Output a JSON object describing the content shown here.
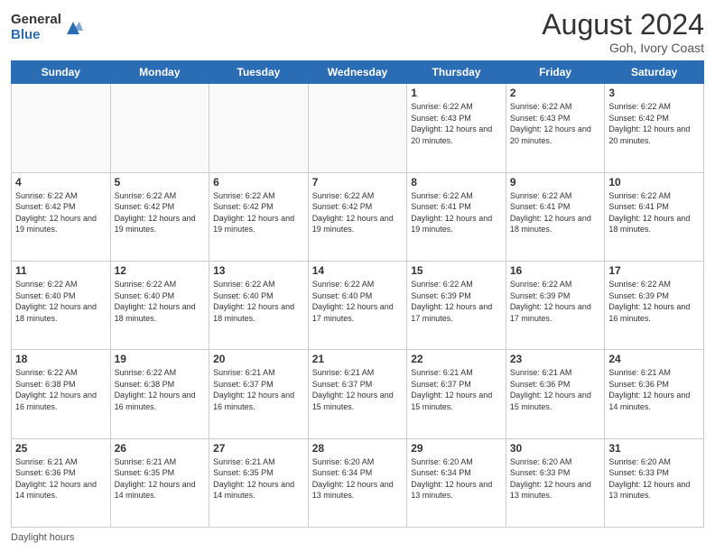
{
  "logo": {
    "general": "General",
    "blue": "Blue"
  },
  "title": "August 2024",
  "location": "Goh, Ivory Coast",
  "days_of_week": [
    "Sunday",
    "Monday",
    "Tuesday",
    "Wednesday",
    "Thursday",
    "Friday",
    "Saturday"
  ],
  "footer": {
    "daylight_label": "Daylight hours"
  },
  "weeks": [
    [
      {
        "day": "",
        "empty": true
      },
      {
        "day": "",
        "empty": true
      },
      {
        "day": "",
        "empty": true
      },
      {
        "day": "",
        "empty": true
      },
      {
        "day": "1",
        "sunrise": "Sunrise: 6:22 AM",
        "sunset": "Sunset: 6:43 PM",
        "daylight": "Daylight: 12 hours and 20 minutes."
      },
      {
        "day": "2",
        "sunrise": "Sunrise: 6:22 AM",
        "sunset": "Sunset: 6:43 PM",
        "daylight": "Daylight: 12 hours and 20 minutes."
      },
      {
        "day": "3",
        "sunrise": "Sunrise: 6:22 AM",
        "sunset": "Sunset: 6:42 PM",
        "daylight": "Daylight: 12 hours and 20 minutes."
      }
    ],
    [
      {
        "day": "4",
        "sunrise": "Sunrise: 6:22 AM",
        "sunset": "Sunset: 6:42 PM",
        "daylight": "Daylight: 12 hours and 19 minutes."
      },
      {
        "day": "5",
        "sunrise": "Sunrise: 6:22 AM",
        "sunset": "Sunset: 6:42 PM",
        "daylight": "Daylight: 12 hours and 19 minutes."
      },
      {
        "day": "6",
        "sunrise": "Sunrise: 6:22 AM",
        "sunset": "Sunset: 6:42 PM",
        "daylight": "Daylight: 12 hours and 19 minutes."
      },
      {
        "day": "7",
        "sunrise": "Sunrise: 6:22 AM",
        "sunset": "Sunset: 6:42 PM",
        "daylight": "Daylight: 12 hours and 19 minutes."
      },
      {
        "day": "8",
        "sunrise": "Sunrise: 6:22 AM",
        "sunset": "Sunset: 6:41 PM",
        "daylight": "Daylight: 12 hours and 19 minutes."
      },
      {
        "day": "9",
        "sunrise": "Sunrise: 6:22 AM",
        "sunset": "Sunset: 6:41 PM",
        "daylight": "Daylight: 12 hours and 18 minutes."
      },
      {
        "day": "10",
        "sunrise": "Sunrise: 6:22 AM",
        "sunset": "Sunset: 6:41 PM",
        "daylight": "Daylight: 12 hours and 18 minutes."
      }
    ],
    [
      {
        "day": "11",
        "sunrise": "Sunrise: 6:22 AM",
        "sunset": "Sunset: 6:40 PM",
        "daylight": "Daylight: 12 hours and 18 minutes."
      },
      {
        "day": "12",
        "sunrise": "Sunrise: 6:22 AM",
        "sunset": "Sunset: 6:40 PM",
        "daylight": "Daylight: 12 hours and 18 minutes."
      },
      {
        "day": "13",
        "sunrise": "Sunrise: 6:22 AM",
        "sunset": "Sunset: 6:40 PM",
        "daylight": "Daylight: 12 hours and 18 minutes."
      },
      {
        "day": "14",
        "sunrise": "Sunrise: 6:22 AM",
        "sunset": "Sunset: 6:40 PM",
        "daylight": "Daylight: 12 hours and 17 minutes."
      },
      {
        "day": "15",
        "sunrise": "Sunrise: 6:22 AM",
        "sunset": "Sunset: 6:39 PM",
        "daylight": "Daylight: 12 hours and 17 minutes."
      },
      {
        "day": "16",
        "sunrise": "Sunrise: 6:22 AM",
        "sunset": "Sunset: 6:39 PM",
        "daylight": "Daylight: 12 hours and 17 minutes."
      },
      {
        "day": "17",
        "sunrise": "Sunrise: 6:22 AM",
        "sunset": "Sunset: 6:39 PM",
        "daylight": "Daylight: 12 hours and 16 minutes."
      }
    ],
    [
      {
        "day": "18",
        "sunrise": "Sunrise: 6:22 AM",
        "sunset": "Sunset: 6:38 PM",
        "daylight": "Daylight: 12 hours and 16 minutes."
      },
      {
        "day": "19",
        "sunrise": "Sunrise: 6:22 AM",
        "sunset": "Sunset: 6:38 PM",
        "daylight": "Daylight: 12 hours and 16 minutes."
      },
      {
        "day": "20",
        "sunrise": "Sunrise: 6:21 AM",
        "sunset": "Sunset: 6:37 PM",
        "daylight": "Daylight: 12 hours and 16 minutes."
      },
      {
        "day": "21",
        "sunrise": "Sunrise: 6:21 AM",
        "sunset": "Sunset: 6:37 PM",
        "daylight": "Daylight: 12 hours and 15 minutes."
      },
      {
        "day": "22",
        "sunrise": "Sunrise: 6:21 AM",
        "sunset": "Sunset: 6:37 PM",
        "daylight": "Daylight: 12 hours and 15 minutes."
      },
      {
        "day": "23",
        "sunrise": "Sunrise: 6:21 AM",
        "sunset": "Sunset: 6:36 PM",
        "daylight": "Daylight: 12 hours and 15 minutes."
      },
      {
        "day": "24",
        "sunrise": "Sunrise: 6:21 AM",
        "sunset": "Sunset: 6:36 PM",
        "daylight": "Daylight: 12 hours and 14 minutes."
      }
    ],
    [
      {
        "day": "25",
        "sunrise": "Sunrise: 6:21 AM",
        "sunset": "Sunset: 6:36 PM",
        "daylight": "Daylight: 12 hours and 14 minutes."
      },
      {
        "day": "26",
        "sunrise": "Sunrise: 6:21 AM",
        "sunset": "Sunset: 6:35 PM",
        "daylight": "Daylight: 12 hours and 14 minutes."
      },
      {
        "day": "27",
        "sunrise": "Sunrise: 6:21 AM",
        "sunset": "Sunset: 6:35 PM",
        "daylight": "Daylight: 12 hours and 14 minutes."
      },
      {
        "day": "28",
        "sunrise": "Sunrise: 6:20 AM",
        "sunset": "Sunset: 6:34 PM",
        "daylight": "Daylight: 12 hours and 13 minutes."
      },
      {
        "day": "29",
        "sunrise": "Sunrise: 6:20 AM",
        "sunset": "Sunset: 6:34 PM",
        "daylight": "Daylight: 12 hours and 13 minutes."
      },
      {
        "day": "30",
        "sunrise": "Sunrise: 6:20 AM",
        "sunset": "Sunset: 6:33 PM",
        "daylight": "Daylight: 12 hours and 13 minutes."
      },
      {
        "day": "31",
        "sunrise": "Sunrise: 6:20 AM",
        "sunset": "Sunset: 6:33 PM",
        "daylight": "Daylight: 12 hours and 13 minutes."
      }
    ]
  ]
}
